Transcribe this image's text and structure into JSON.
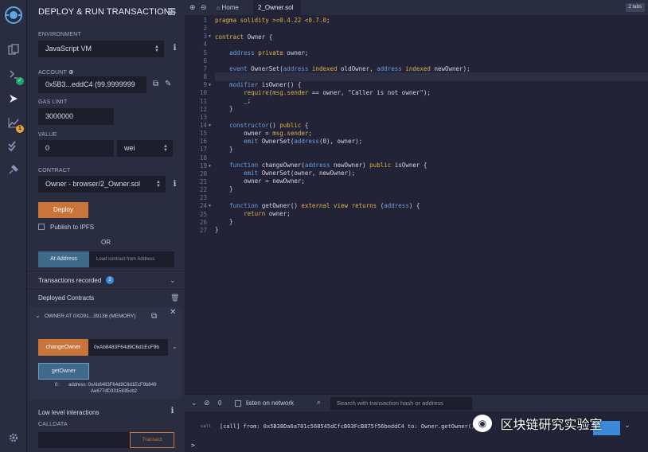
{
  "panel": {
    "title": "DEPLOY & RUN TRANSACTIONS",
    "environment_label": "ENVIRONMENT",
    "environment_value": "JavaScript VM",
    "account_label": "ACCOUNT",
    "account_value": "0x5B3...eddC4 (99.9999999",
    "gas_limit_label": "GAS LIMIT",
    "gas_limit_value": "3000000",
    "value_label": "VALUE",
    "value_amount": "0",
    "value_unit": "wei",
    "contract_label": "CONTRACT",
    "contract_value": "Owner - browser/2_Owner.sol",
    "deploy_label": "Deploy",
    "publish_label": "Publish to IPFS",
    "or_label": "OR",
    "at_address_label": "At Address",
    "load_contract_placeholder": "Load contract from Address",
    "transactions_recorded_label": "Transactions recorded",
    "transactions_count": "2",
    "deployed_contracts_label": "Deployed Contracts",
    "instance_label": "OWNER AT 0XD91...39138 (MEMORY)",
    "change_owner_label": "changeOwner",
    "change_owner_input": "0xAb8483F64d9C6d1EcF9b",
    "get_owner_label": "getOwner",
    "result_index": "0:",
    "result_line1": "address: 0xAb8483F64d9C6d1EcF9b849",
    "result_line2": "Ae677dD3315835cb2",
    "low_level_label": "Low level interactions",
    "calldata_label": "CALLDATA",
    "transact_label": "Transact"
  },
  "editor": {
    "tabs": [
      {
        "label": "Home"
      },
      {
        "label": "2_Owner.sol"
      }
    ],
    "tab_count": "2 tabs",
    "lines": [
      "1",
      "2",
      "3",
      "4",
      "5",
      "6",
      "7",
      "8",
      "9",
      "10",
      "11",
      "12",
      "13",
      "14",
      "15",
      "16",
      "17",
      "18",
      "19",
      "20",
      "21",
      "22",
      "23",
      "24",
      "25",
      "26",
      "27"
    ]
  },
  "terminal": {
    "count": "0",
    "listen_label": "listen on network",
    "search_placeholder": "Search with transaction hash or address",
    "log_tag": "call",
    "log_line": "[call]  from: 0x5B38Da6a701c568545dCfcB03FcB875f56beddC4 to: Owner.getOwner()",
    "prompt": ">"
  },
  "watermark": "区块链研究实验室",
  "colors": {
    "accent_orange": "#c97539",
    "panel_bg": "#2a2c3f",
    "editor_bg": "#222336",
    "badge_blue": "#3b8ad9",
    "keyword": "#e0b24a"
  }
}
